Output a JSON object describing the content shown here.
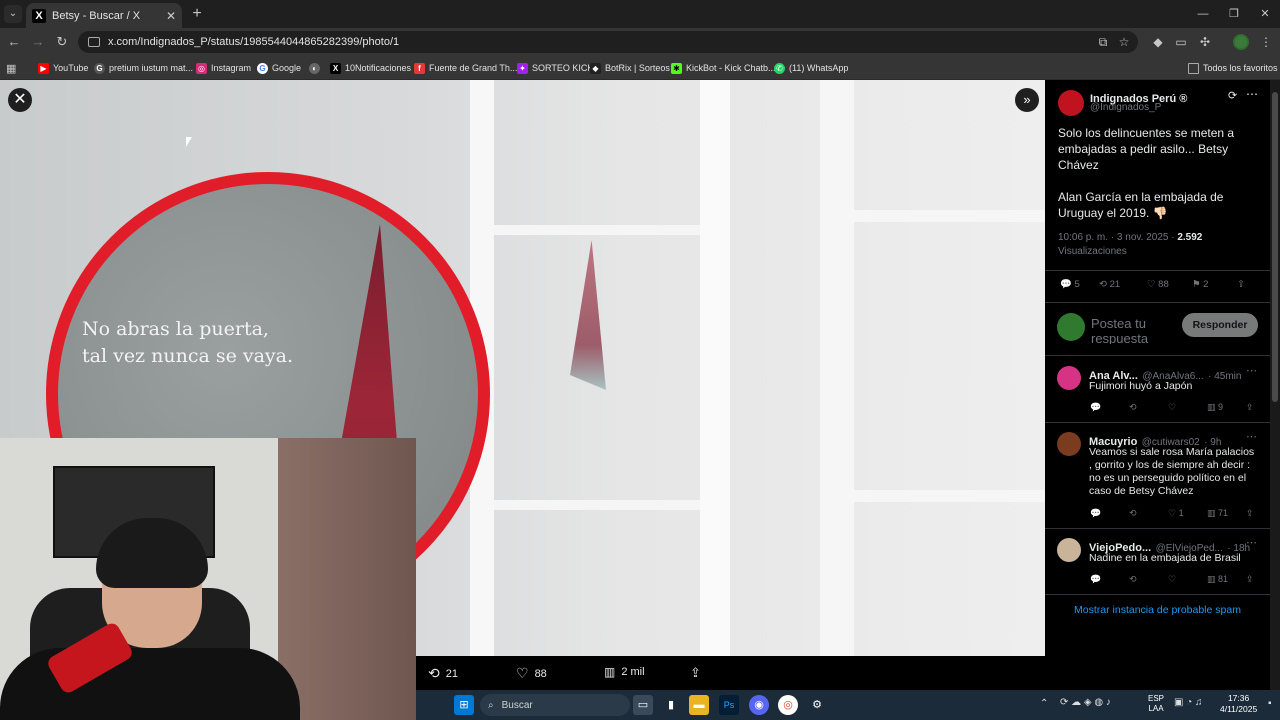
{
  "browser": {
    "tab_title": "Betsy - Buscar / X",
    "url": "x.com/Indignados_P/status/1985544044865282399/photo/1",
    "bookmarks": [
      "YouTube",
      "pretium iustum mat...",
      "Instagram",
      "Google",
      "10Notificaciones",
      "Fuente de Grand Th...",
      "SORTEO KICK",
      "BotRix | Sorteos",
      "KickBot - Kick Chatb...",
      "(11) WhatsApp"
    ],
    "all_bookmarks": "Todos los favoritos"
  },
  "image": {
    "overlay_text_1": "No abras la puerta,",
    "overlay_text_2": "tal vez nunca se vaya."
  },
  "media_actions": {
    "retweets": "21",
    "likes": "88",
    "views": "2 mil"
  },
  "tweet": {
    "author_name": "Indignados Perú ®",
    "author_handle": "@Indignados_P",
    "text_1": "Solo los delincuentes se meten a embajadas a pedir asilo... Betsy Chávez",
    "text_2": "Alan García en la embajada de Uruguay el 2019. 👎🏻",
    "timestamp": "10:06 p. m. · 3 nov. 2025 · ",
    "views_count": "2.592",
    "views_label": "Visualizaciones",
    "replies": "5",
    "retweets": "21",
    "likes": "88",
    "bookmarks": "2"
  },
  "reply_box": {
    "placeholder": "Postea tu respuesta",
    "button": "Responder"
  },
  "replies": [
    {
      "name": "Ana Alv...",
      "handle": "@AnaAlva6...",
      "time": "· 45min",
      "text": "Fujimori huyó a Japón",
      "likes": "",
      "views": "9"
    },
    {
      "name": "Macuyrio",
      "handle": "@cutiwars02",
      "time": "· 9h",
      "text": "Veamos si sale rosa María palacios , gorrito y los de siempre ah decir : no es un perseguido político en el caso de Betsy Chávez",
      "likes": "1",
      "views": "71"
    },
    {
      "name": "ViejoPedo...",
      "handle": "@ElViejoPed...",
      "time": "· 18h",
      "text": "Nadine en la embajada de Brasil",
      "likes": "",
      "views": "81"
    }
  ],
  "spam_link": "Mostrar instancia de probable spam",
  "taskbar": {
    "search": "Buscar",
    "lang_1": "ESP",
    "lang_2": "LAA",
    "time": "17:36",
    "date": "4/11/2025"
  },
  "colors": {
    "accent": "#1d9bf0",
    "bubble_border": "#e11d2a",
    "panel_bg": "#000000"
  }
}
